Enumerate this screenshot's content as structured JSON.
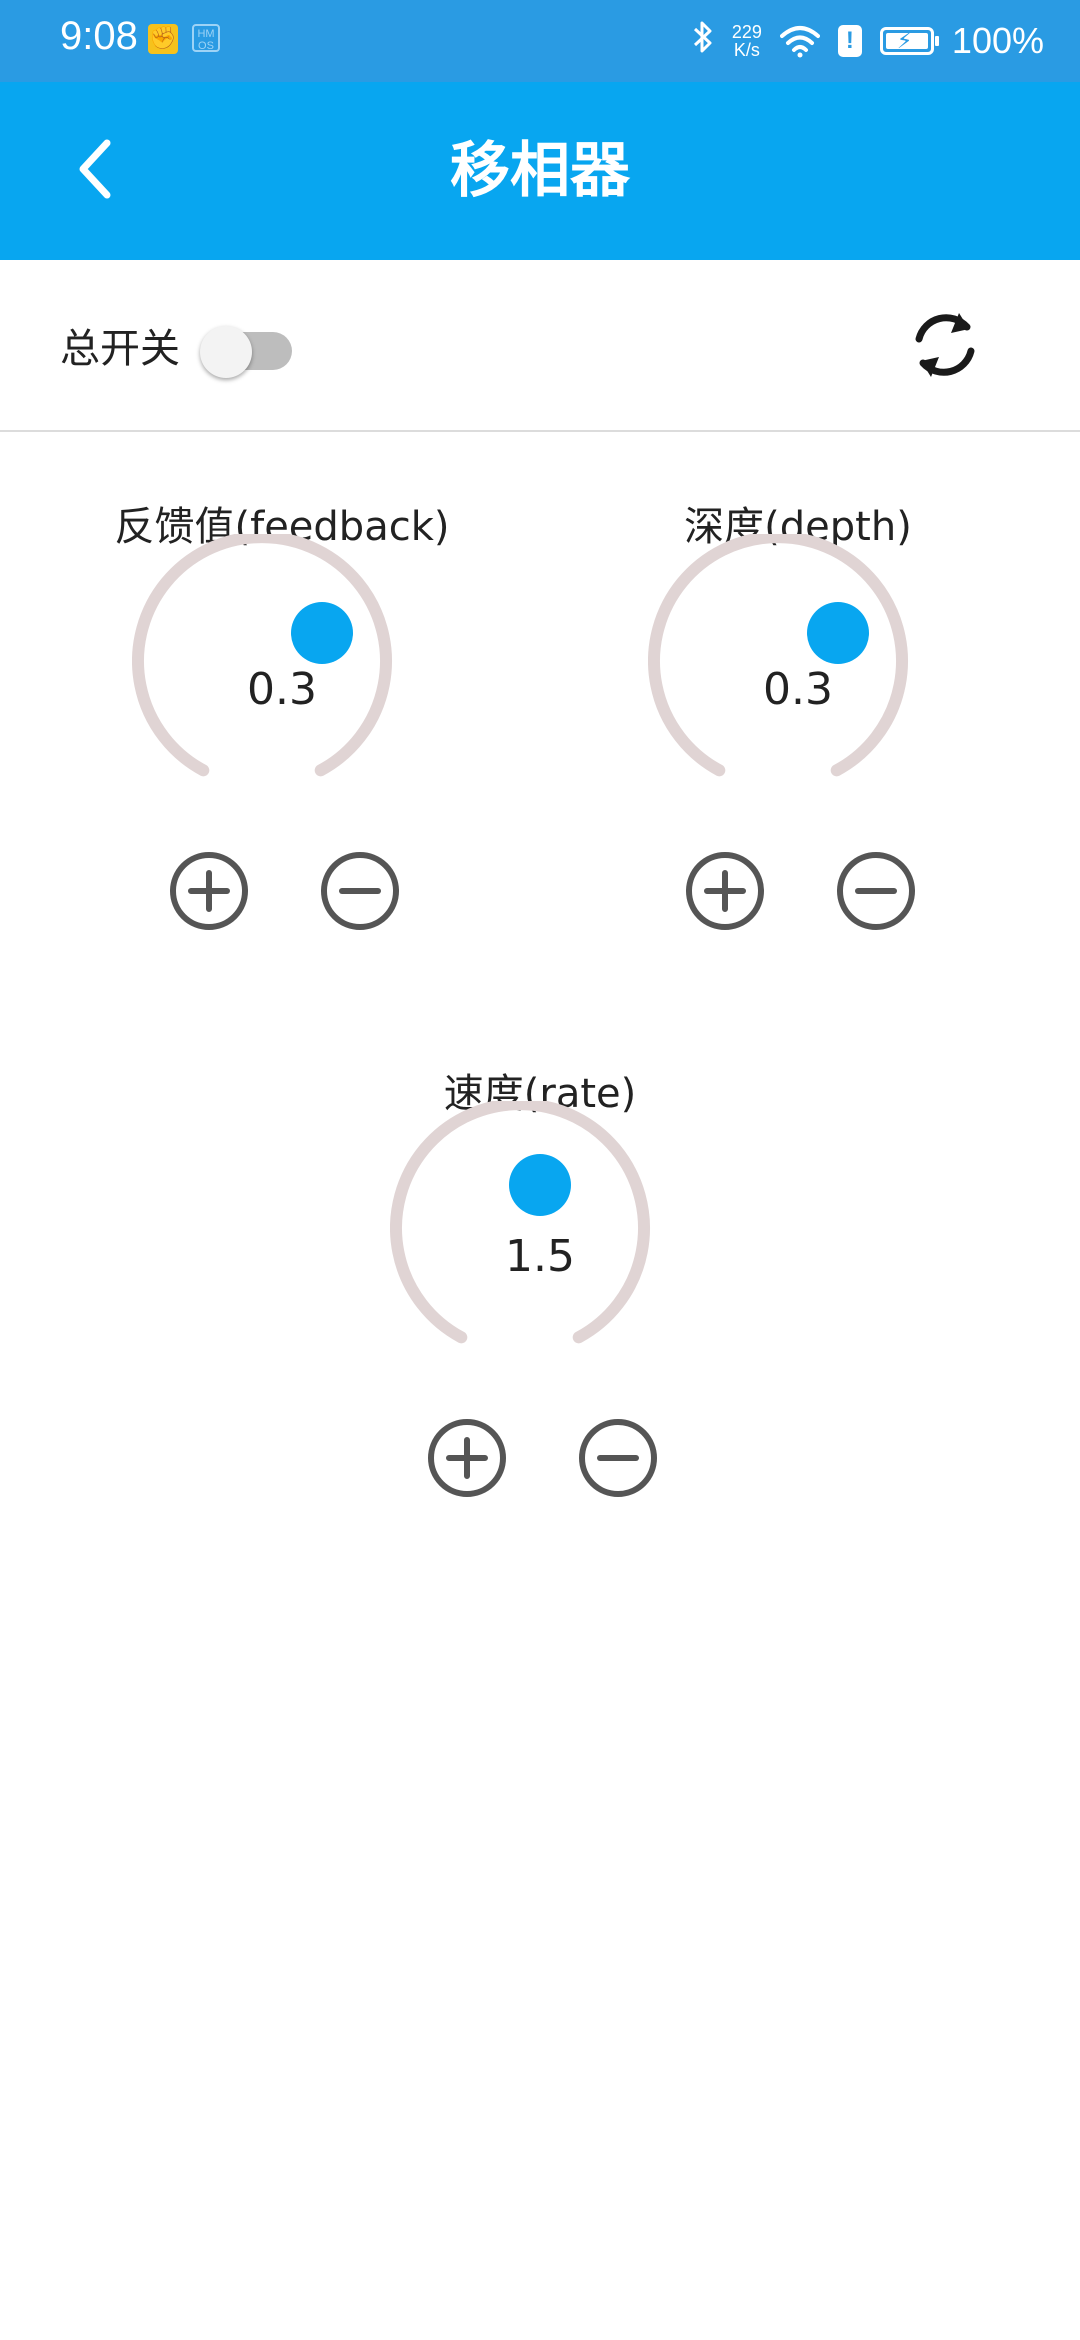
{
  "status_bar": {
    "time": "9:08",
    "app_icon": "clapper-icon",
    "hm_label": "HM\nOS",
    "bluetooth_icon": "bluetooth-icon",
    "speed_value": "229",
    "speed_unit": "K/s",
    "wifi_icon": "wifi-icon",
    "alert_icon": "!",
    "battery_percent": "100%"
  },
  "app_bar": {
    "title": "移相器",
    "back_icon": "chevron-left-icon"
  },
  "master": {
    "label": "总开关",
    "switch_on": false,
    "refresh_icon": "refresh-icon"
  },
  "knobs": [
    {
      "id": "feedback",
      "label": "反馈值(feedback)",
      "value": "0.3"
    },
    {
      "id": "depth",
      "label": "深度(depth)",
      "value": "0.3"
    },
    {
      "id": "rate",
      "label": "速度(rate)",
      "value": "1.5"
    }
  ],
  "colors": {
    "status_bar": "#2a9be3",
    "app_bar": "#08a6f0",
    "knob_track": "#e0d4d4",
    "knob_handle": "#08a6f0",
    "button_icon": "#555555"
  }
}
